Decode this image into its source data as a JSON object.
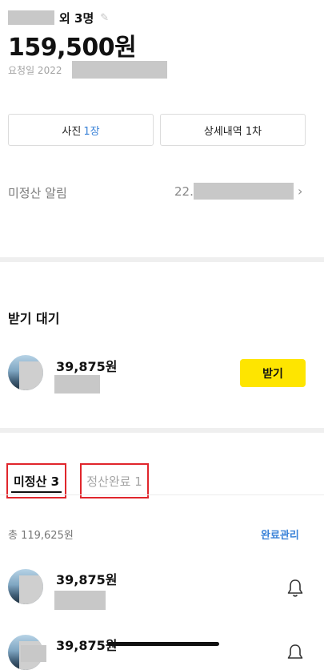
{
  "header": {
    "title_suffix": "외 3명",
    "total_amount": "159,500원",
    "request_date_prefix": "요청일 2022"
  },
  "buttons": {
    "photo_label": "사진",
    "photo_count": "1장",
    "detail_label": "상세내역 1차"
  },
  "alarm": {
    "label": "미정산 알림",
    "value_prefix": "22."
  },
  "waiting": {
    "title": "받기 대기",
    "amount": "39,875원",
    "receive_label": "받기"
  },
  "tabs": {
    "unpaid_label": "미정산 3",
    "done_label": "정산완료 1"
  },
  "summary": {
    "total_label": "총 119,625원",
    "manage_label": "완료관리"
  },
  "unpaid_list": [
    {
      "amount": "39,875원"
    },
    {
      "amount": "39,875원"
    }
  ],
  "colors": {
    "accent_blue": "#3a82d8",
    "receive_yellow": "#fee500",
    "highlight_red": "#e0262c"
  },
  "icons": {
    "edit": "pencil-icon",
    "chevron": "chevron-right-icon",
    "bell": "bell-icon"
  }
}
